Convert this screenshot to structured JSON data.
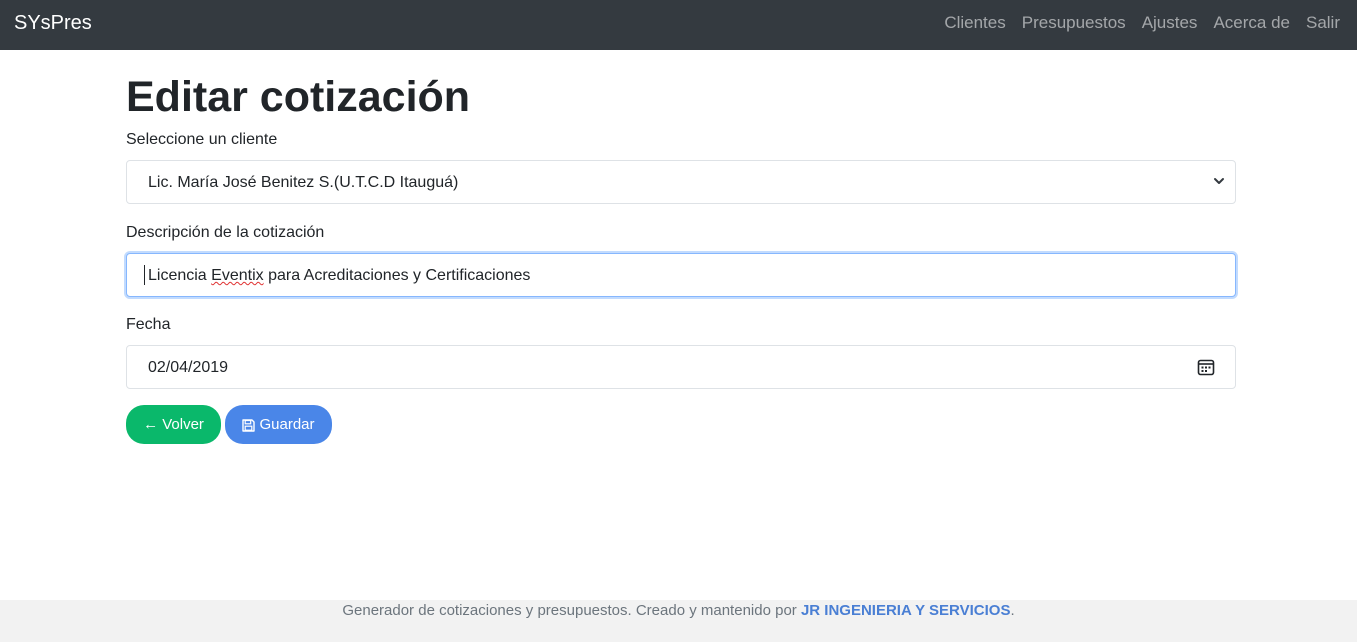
{
  "navbar": {
    "brand": "SYsPres",
    "links": [
      "Clientes",
      "Presupuestos",
      "Ajustes",
      "Acerca de",
      "Salir"
    ]
  },
  "page": {
    "title": "Editar cotización"
  },
  "form": {
    "client_label": "Seleccione un cliente",
    "client_value": "Lic. María José Benitez S.(U.T.C.D Itauguá)",
    "description_label": "Descripción de la cotización",
    "description_prefix": "Licencia ",
    "description_misspelled": "Eventix",
    "description_suffix": " para Acreditaciones y Certificaciones",
    "date_label": "Fecha",
    "date_value": "02/04/2019"
  },
  "buttons": {
    "back_label": "← Volver",
    "save_label": "Guardar"
  },
  "footer": {
    "text_before": "Generador de cotizaciones y presupuestos. Creado y mantenido por ",
    "company": "JR INGENIERIA Y SERVICIOS",
    "text_after": "."
  },
  "icons": {
    "select": "chevron-down-icon",
    "date": "calendar-icon",
    "save": "floppy-disk-icon"
  },
  "colors": {
    "navbar": "#343a40",
    "back_button": "#0ab86b",
    "save_button": "#4a86e8",
    "focus_border": "#86b7fe",
    "footer_link": "#4a7fd4"
  }
}
